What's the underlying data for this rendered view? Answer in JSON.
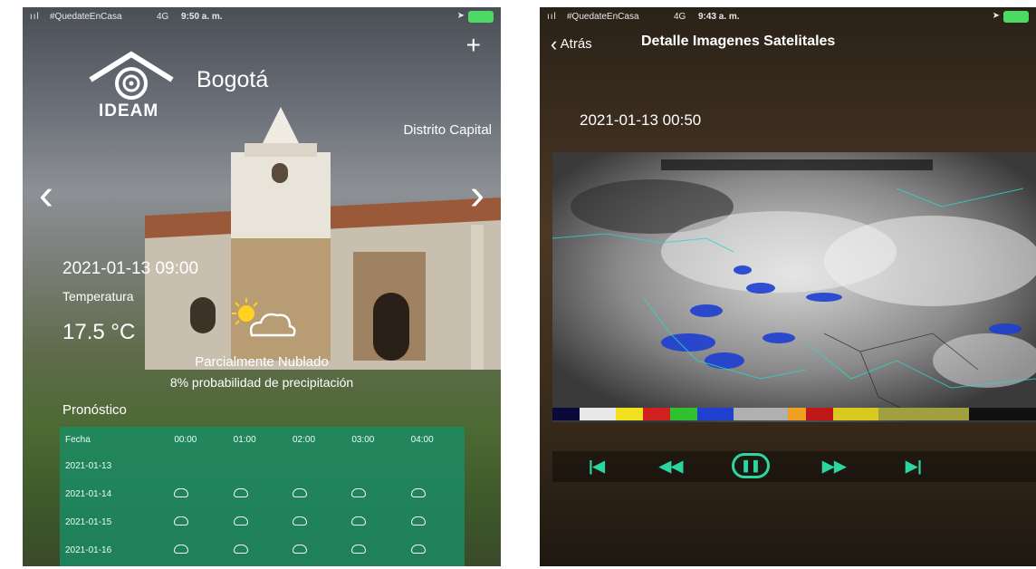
{
  "left": {
    "status": {
      "signal": "ııl",
      "carrier": "#QuedateEnCasa",
      "network": "4G",
      "time": "9:50 a. m."
    },
    "brand": "IDEAM",
    "city": "Bogotá",
    "region": "Distrito Capital",
    "add_label": "+",
    "prev_label": "‹",
    "next_label": "›",
    "datetime": "2021-01-13 09:00",
    "temperature_label": "Temperatura",
    "temperature_value": "17.5 °C",
    "condition": "Parcialmente Nublado",
    "precip": "8% probabilidad de precipitación",
    "forecast_title": "Pronóstico",
    "forecast": {
      "headers": [
        "Fecha",
        "00:00",
        "01:00",
        "02:00",
        "03:00",
        "04:00"
      ],
      "rows": [
        {
          "date": "2021-01-13",
          "icons": []
        },
        {
          "date": "2021-01-14",
          "icons": [
            "cloud-icon",
            "cloud-icon",
            "cloud-icon",
            "cloud-icon",
            "cloud-icon"
          ]
        },
        {
          "date": "2021-01-15",
          "icons": [
            "cloud-icon",
            "cloud-icon",
            "cloud-icon",
            "cloud-icon",
            "cloud-icon"
          ]
        },
        {
          "date": "2021-01-16",
          "icons": [
            "cloud-icon",
            "cloud-icon",
            "cloud-icon",
            "cloud-icon",
            "cloud-icon"
          ]
        }
      ]
    }
  },
  "right": {
    "status": {
      "signal": "ııl",
      "carrier": "#QuedateEnCasa",
      "network": "4G",
      "time": "9:43 a. m."
    },
    "back_label": "Atrás",
    "title": "Detalle Imagenes Satelitales",
    "image_time": "2021-01-13 00:50",
    "controls": [
      "first-icon",
      "rewind-icon",
      "pause-icon",
      "forward-icon",
      "last-icon"
    ]
  },
  "colors": {
    "accent": "#2bd7a0",
    "forecast_bg": "#1a8c64",
    "battery": "#4cd964"
  }
}
